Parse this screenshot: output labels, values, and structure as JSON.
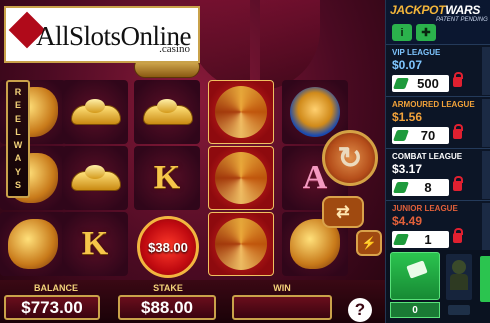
{
  "watermark": {
    "brand": "AllSlotsOnline",
    "suffix": ".casino"
  },
  "reel_label": [
    "R",
    "E",
    "E",
    "L",
    "W",
    "A",
    "Y",
    "S"
  ],
  "reels": [
    [
      "ingot",
      "dragon",
      "tiger"
    ],
    [
      "ingot",
      "ingot",
      "letter-k"
    ],
    [
      "ingot",
      "letter-k",
      "big-win"
    ],
    [
      "dragon",
      "dragon",
      "dragon"
    ],
    [
      "tiger",
      "letter-a",
      "phoenix"
    ]
  ],
  "big_win_amount": "$38.00",
  "controls": {
    "balance_label": "BALANCE",
    "balance_value": "$773.00",
    "stake_label": "STAKE",
    "stake_value": "$88.00",
    "win_label": "WIN",
    "win_value": "",
    "help_label": "?",
    "spin_icon": "refresh-arrow",
    "autoplay_icon": "autoplay-arrows"
  },
  "jackpot": {
    "title_a": "JACKPOT",
    "title_b": "WARS",
    "subtitle": "PATENT PENDING",
    "info_label": "i",
    "leagues": [
      {
        "name": "VIP LEAGUE",
        "amount": "$0.07",
        "count": "500",
        "name_color": "#7fc6ff",
        "amount_color": "#7fc6ff"
      },
      {
        "name": "ARMOURED LEAGUE",
        "amount": "$1.56",
        "count": "70",
        "name_color": "#f2a23a",
        "amount_color": "#f2a23a"
      },
      {
        "name": "COMBAT LEAGUE",
        "amount": "$3.17",
        "count": "8",
        "name_color": "#ffffff",
        "amount_color": "#ffffff"
      },
      {
        "name": "JUNIOR LEAGUE",
        "amount": "$4.49",
        "count": "1",
        "name_color": "#e2603a",
        "amount_color": "#e2603a"
      }
    ],
    "tickets_count": "0"
  },
  "colors": {
    "gold": "#c9a24a",
    "panel_bg": "#0c1526",
    "accent_green": "#2bc44f"
  }
}
